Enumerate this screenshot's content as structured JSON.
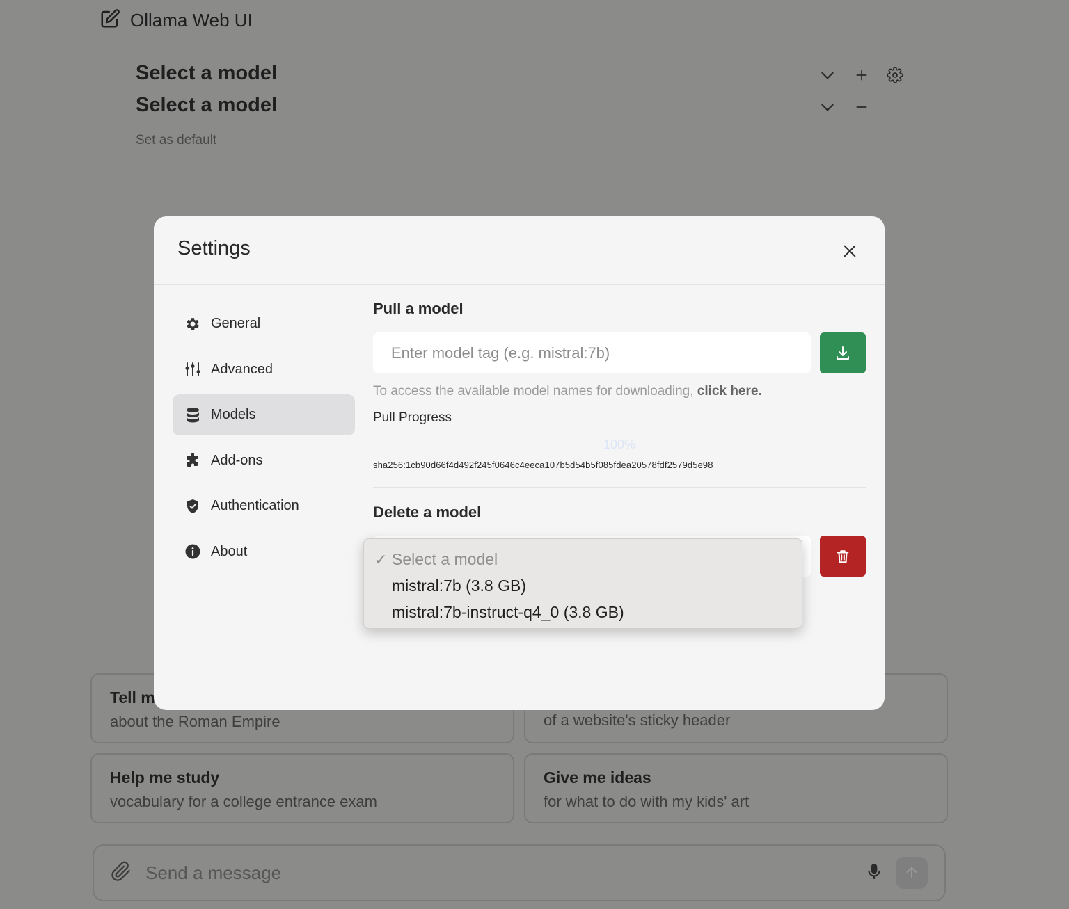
{
  "app": {
    "title": "Ollama Web UI",
    "model_selectors": [
      {
        "label": "Select a model"
      },
      {
        "label": "Select a model"
      }
    ],
    "set_default": "Set as default"
  },
  "suggestions": [
    {
      "title": "Tell me",
      "subtitle": "about the Roman Empire"
    },
    {
      "title": "",
      "subtitle": "of a website's sticky header"
    },
    {
      "title": "Help me study",
      "subtitle": "vocabulary for a college entrance exam"
    },
    {
      "title": "Give me ideas",
      "subtitle": "for what to do with my kids' art"
    }
  ],
  "composer": {
    "placeholder": "Send a message"
  },
  "settings": {
    "title": "Settings",
    "sidebar": [
      {
        "label": "General",
        "icon": "gear-icon"
      },
      {
        "label": "Advanced",
        "icon": "sliders-icon"
      },
      {
        "label": "Models",
        "icon": "database-icon",
        "active": true
      },
      {
        "label": "Add-ons",
        "icon": "puzzle-icon"
      },
      {
        "label": "Authentication",
        "icon": "shield-icon"
      },
      {
        "label": "About",
        "icon": "info-icon"
      }
    ],
    "pull": {
      "title": "Pull a model",
      "placeholder": "Enter model tag (e.g. mistral:7b)",
      "hint": "To access the available model names for downloading,",
      "hint_link": "click here.",
      "progress_label": "Pull Progress",
      "progress_percent": "100%",
      "digest": "sha256:1cb90d66f4d492f245f0646c4eeca107b5d54b5f085fdea20578fdf2579d5e98"
    },
    "delete": {
      "title": "Delete a model",
      "options": [
        {
          "label": "Select a model",
          "selected": true
        },
        {
          "label": "mistral:7b (3.8 GB)"
        },
        {
          "label": "mistral:7b-instruct-q4_0 (3.8 GB)"
        }
      ]
    }
  },
  "colors": {
    "download": "#2f8f55",
    "delete": "#b52424",
    "overlay": "#8b8b8a"
  }
}
